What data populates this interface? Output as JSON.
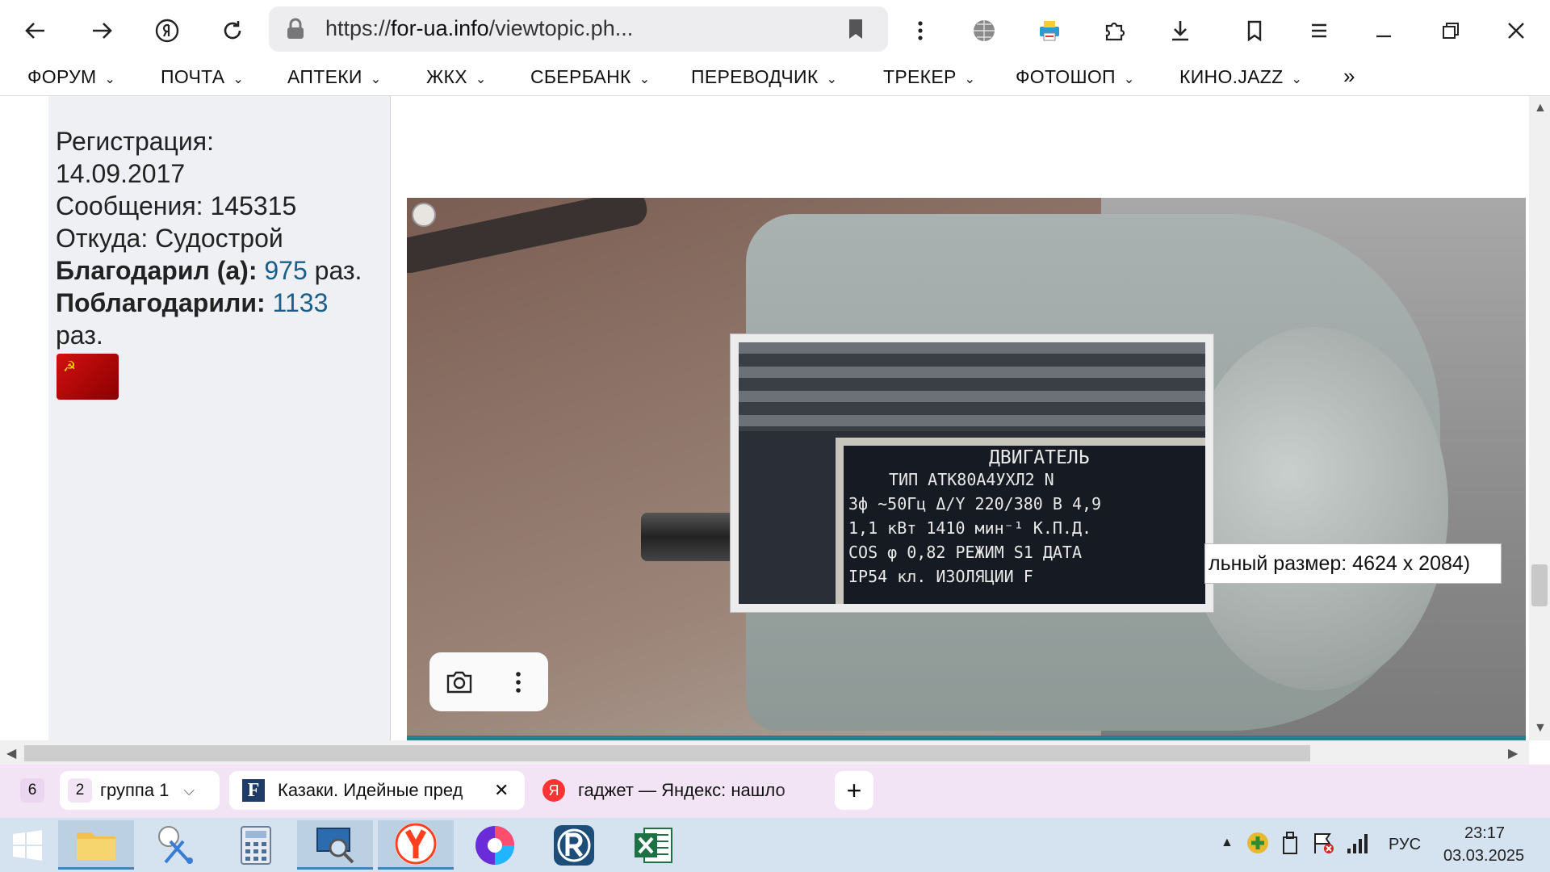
{
  "browser": {
    "url_prefix": "https://",
    "url_domain": "for-ua.info",
    "url_path": "/viewtopic.ph..."
  },
  "bookmarks": [
    {
      "label": "ФОРУМ"
    },
    {
      "label": "ПОЧТА"
    },
    {
      "label": "АПТЕКИ"
    },
    {
      "label": "ЖКХ"
    },
    {
      "label": "СБЕРБАНК"
    },
    {
      "label": "ПЕРЕВОДЧИК"
    },
    {
      "label": "ТРЕКЕР"
    },
    {
      "label": "ФОТОШОП"
    },
    {
      "label": "КИНО.JAZZ"
    }
  ],
  "bookmarks_more": "»",
  "profile": {
    "reg_label": "Регистрация:",
    "reg_date": "14.09.2017",
    "messages": "Сообщения: 145315",
    "from": "Откуда: Судострой",
    "thanked_label": "Благодарил (а):",
    "thanked_count": "975",
    "thanked_suffix": " раз.",
    "got_thanked_label": "Поблагодарили:",
    "got_thanked_count": "1133",
    "got_thanked_suffix": "раз."
  },
  "nameplate": {
    "title": "ДВИГАТЕЛЬ",
    "line1": "ТИП АТК80А4УХЛ2 N",
    "line2": "3ф  ~50Гц  Δ/Y  220/380 В  4,9",
    "line3": "1,1 кВт   1410 мин⁻¹   К.П.Д.",
    "line4": "COS φ 0,82   РЕЖИМ S1   ДАТА",
    "line5": "IP54   кл. ИЗОЛЯЦИИ F"
  },
  "tooltip": "льный размер: 4624 x 2084)",
  "tabs": {
    "count": "6",
    "group_num": "2",
    "group_label": "группа 1",
    "tab1": "Казаки. Идейные пред",
    "tab2": "гаджет — Яндекс: нашло"
  },
  "taskbar": {
    "lang": "РУС",
    "time": "23:17",
    "date": "03.03.2025"
  }
}
